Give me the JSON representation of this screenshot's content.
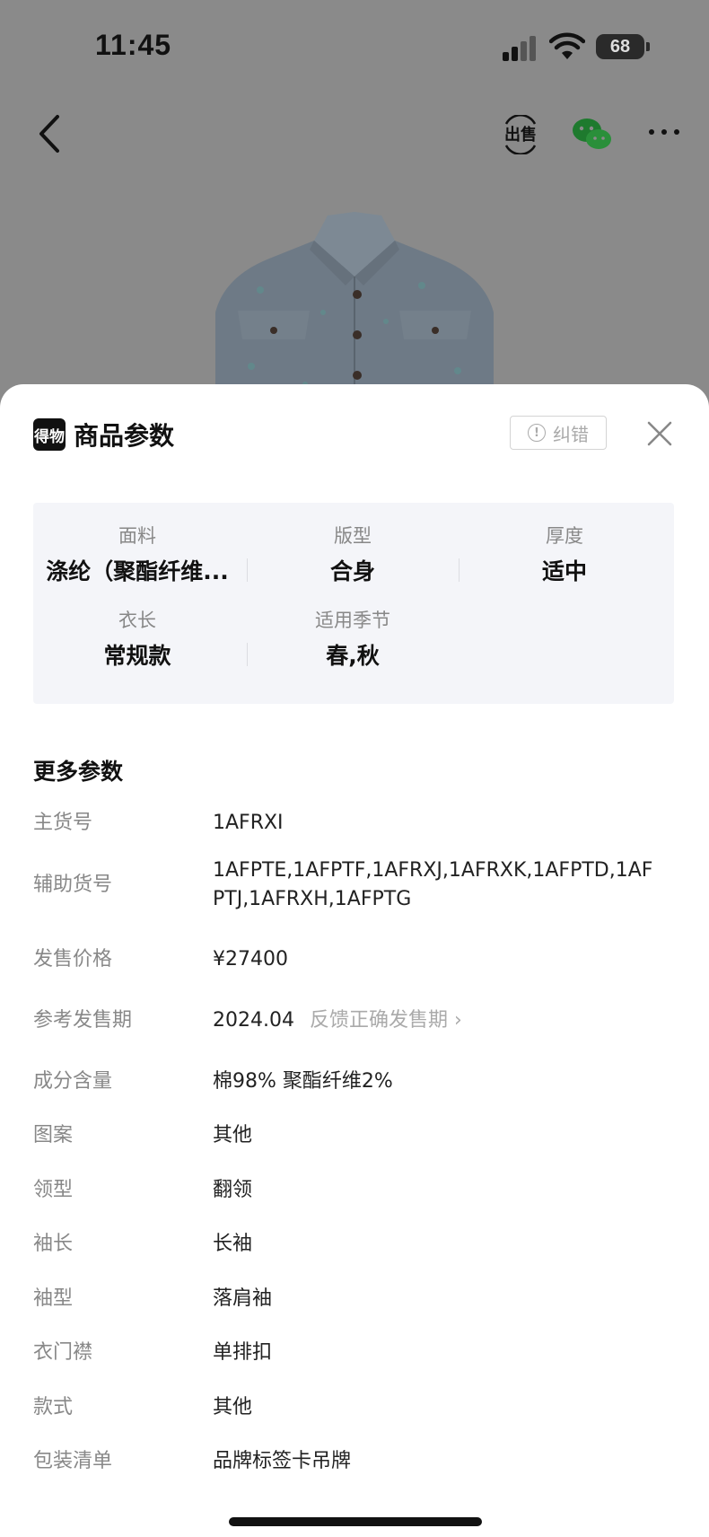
{
  "status_bar": {
    "time": "11:45",
    "battery": "68"
  },
  "nav": {
    "back_icon": "chevron-left-icon",
    "sell_label": "出售",
    "share_icon": "wechat-icon",
    "more_icon": "more-dots-icon"
  },
  "sheet": {
    "brand_logo": "得物",
    "title": "商品参数",
    "report_label": "纠错",
    "report_icon": "exclamation-circle-icon",
    "close_icon": "close-icon"
  },
  "key_params": [
    {
      "label": "面料",
      "value": "涤纶（聚酯纤维..."
    },
    {
      "label": "版型",
      "value": "合身"
    },
    {
      "label": "厚度",
      "value": "适中"
    },
    {
      "label": "衣长",
      "value": "常规款"
    },
    {
      "label": "适用季节",
      "value": "春,秋"
    }
  ],
  "more_params": {
    "title": "更多参数",
    "rows": [
      {
        "label": "主货号",
        "value": "1AFRXI"
      },
      {
        "label": "辅助货号",
        "value": "1AFPTE,1AFPTF,1AFRXJ,1AFRXK,1AFPTD,1AFPTJ,1AFRXH,1AFPTG"
      },
      {
        "label": "发售价格",
        "value": "¥27400"
      },
      {
        "label": "参考发售期",
        "value": "2024.04",
        "link": "反馈正确发售期 ›"
      },
      {
        "label": "成分含量",
        "value": "棉98% 聚酯纤维2%"
      },
      {
        "label": "图案",
        "value": "其他"
      },
      {
        "label": "领型",
        "value": "翻领"
      },
      {
        "label": "袖长",
        "value": "长袖"
      },
      {
        "label": "袖型",
        "value": "落肩袖"
      },
      {
        "label": "衣门襟",
        "value": "单排扣"
      },
      {
        "label": "款式",
        "value": "其他"
      },
      {
        "label": "包装清单",
        "value": "品牌标签卡吊牌"
      }
    ]
  }
}
